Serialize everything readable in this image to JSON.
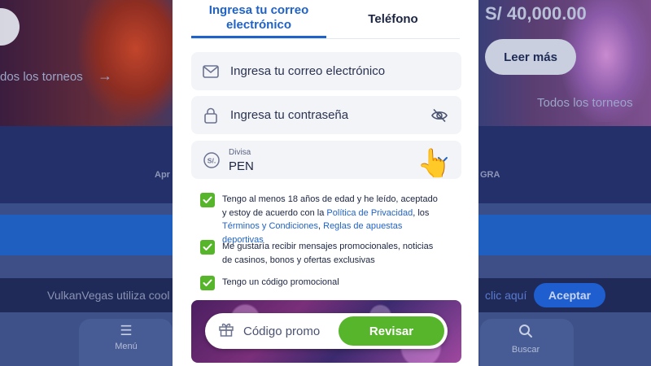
{
  "background": {
    "jackpot_amount": "S/ 40,000.00",
    "read_more_label": "Leer más",
    "all_tournaments_left": "dos los torneos",
    "all_tournaments_right": "Todos los torneos",
    "band_text_left": "Apr",
    "band_text_right": "GRA",
    "cookie_text": "VulkanVegas utiliza cool",
    "cookie_link": "clic aquí",
    "accept_label": "Aceptar",
    "nav_menu_label": "Menú",
    "nav_search_label": "Buscar"
  },
  "modal": {
    "tabs": [
      {
        "label": "Ingresa tu correo electrónico",
        "active": true
      },
      {
        "label": "Teléfono",
        "active": false
      }
    ],
    "email": {
      "placeholder": "Ingresa tu correo electrónico",
      "icon": "envelope-icon"
    },
    "password": {
      "placeholder": "Ingresa tu contraseña",
      "icon": "lock-icon",
      "toggle_icon": "eye-slash-icon"
    },
    "currency": {
      "label": "Divisa",
      "value": "PEN",
      "icon": "currency-sol-icon"
    },
    "checkboxes": {
      "terms": {
        "checked": true,
        "prefix": "Tengo al menos 18 años de edad y he leído, aceptado y estoy de acuerdo con la ",
        "privacy_link": "Política de Privacidad",
        "mid": ", los ",
        "terms_link": "Términos y Condiciones",
        "sep": ", ",
        "betting_link": "Reglas de apuestas deportivas"
      },
      "promo_messages": {
        "checked": true,
        "text": "Me gustaría recibir mensajes promocionales, noticias de casinos, bonos y ofertas exclusivas"
      },
      "promo_code": {
        "checked": true,
        "text": "Tengo un código promocional"
      }
    },
    "promo": {
      "placeholder": "Código promo",
      "button_label": "Revisar",
      "icon": "gift-icon"
    }
  },
  "colors": {
    "accent_blue": "#1f63c9",
    "check_green": "#56b52a",
    "field_bg": "#f3f4f8"
  }
}
